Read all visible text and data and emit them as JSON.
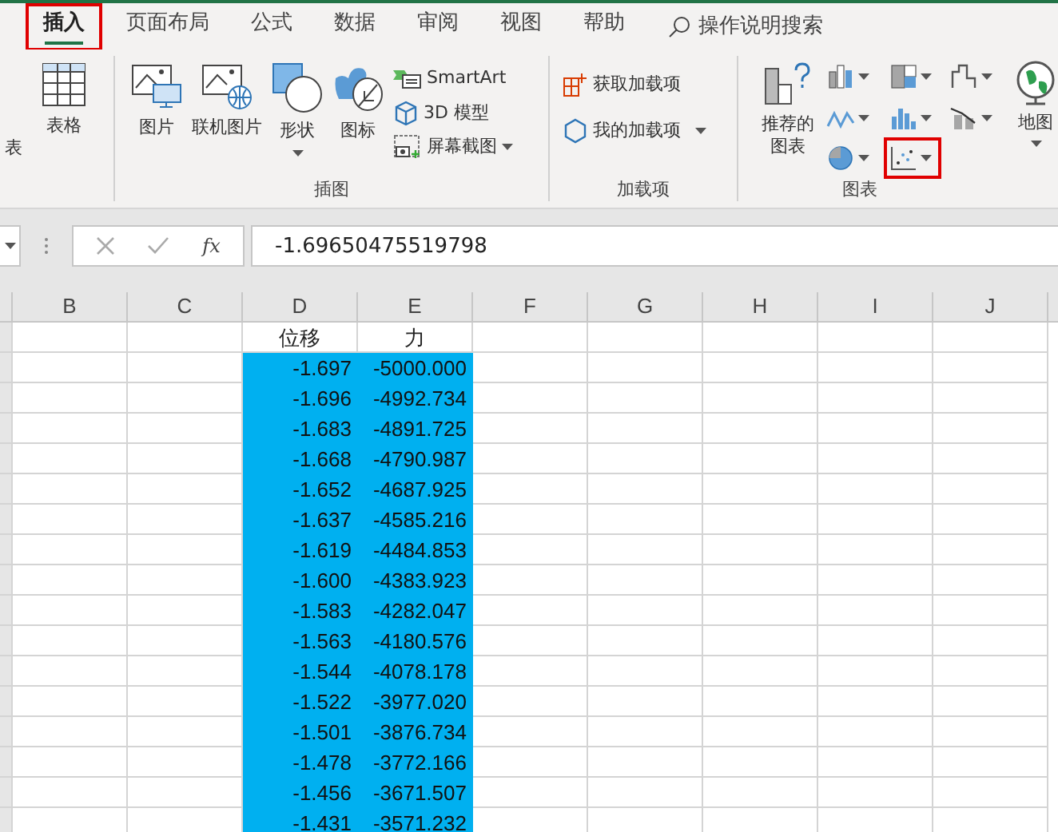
{
  "tabs": [
    {
      "label": "插入",
      "selected": true,
      "highlighted": true
    },
    {
      "label": "页面布局",
      "selected": false,
      "highlighted": false
    },
    {
      "label": "公式",
      "selected": false,
      "highlighted": false
    },
    {
      "label": "数据",
      "selected": false,
      "highlighted": false
    },
    {
      "label": "审阅",
      "selected": false,
      "highlighted": false
    },
    {
      "label": "视图",
      "selected": false,
      "highlighted": false
    },
    {
      "label": "帮助",
      "selected": false,
      "highlighted": false
    }
  ],
  "search": {
    "placeholder": "操作说明搜索"
  },
  "ribbon": {
    "tables_group": {
      "partial_label": "表",
      "items": [
        "表格"
      ]
    },
    "illustrations_group": {
      "label": "插图",
      "large": [
        {
          "label": "图片",
          "dropdown": false
        },
        {
          "label": "联机图片",
          "dropdown": false
        },
        {
          "label": "形状",
          "dropdown": true
        },
        {
          "label": "图标",
          "dropdown": false
        }
      ],
      "small": [
        {
          "label": "SmartArt",
          "dropdown": false
        },
        {
          "label": "3D 模型",
          "dropdown": false
        },
        {
          "label": "屏幕截图",
          "dropdown": true
        }
      ]
    },
    "addins_group": {
      "label": "加载项",
      "items": [
        {
          "label": "获取加载项",
          "dropdown": false
        },
        {
          "label": "我的加载项",
          "dropdown": true
        }
      ]
    },
    "charts_group": {
      "label": "图表",
      "recommended": "推荐的图表",
      "small_charts": [
        {
          "kind": "column",
          "highlighted": false
        },
        {
          "kind": "hierarchy",
          "highlighted": false
        },
        {
          "kind": "waterfall",
          "highlighted": false
        },
        {
          "kind": "line",
          "highlighted": false
        },
        {
          "kind": "statistic",
          "highlighted": false
        },
        {
          "kind": "combo",
          "highlighted": false
        },
        {
          "kind": "pie",
          "highlighted": false
        },
        {
          "kind": "scatter",
          "highlighted": true
        }
      ],
      "map": "地图"
    }
  },
  "formula_bar": {
    "fx": "fx",
    "value": "-1.69650475519798"
  },
  "sheet": {
    "columns": [
      "B",
      "C",
      "D",
      "E",
      "F",
      "G",
      "H",
      "I",
      "J"
    ],
    "headers": {
      "d": "位移",
      "e": "力"
    },
    "rows": [
      {
        "d": "-1.697",
        "e": "-5000.000"
      },
      {
        "d": "-1.696",
        "e": "-4992.734"
      },
      {
        "d": "-1.683",
        "e": "-4891.725"
      },
      {
        "d": "-1.668",
        "e": "-4790.987"
      },
      {
        "d": "-1.652",
        "e": "-4687.925"
      },
      {
        "d": "-1.637",
        "e": "-4585.216"
      },
      {
        "d": "-1.619",
        "e": "-4484.853"
      },
      {
        "d": "-1.600",
        "e": "-4383.923"
      },
      {
        "d": "-1.583",
        "e": "-4282.047"
      },
      {
        "d": "-1.563",
        "e": "-4180.576"
      },
      {
        "d": "-1.544",
        "e": "-4078.178"
      },
      {
        "d": "-1.522",
        "e": "-3977.020"
      },
      {
        "d": "-1.501",
        "e": "-3876.734"
      },
      {
        "d": "-1.478",
        "e": "-3772.166"
      },
      {
        "d": "-1.456",
        "e": "-3671.507"
      },
      {
        "d": "-1.431",
        "e": "-3571.232"
      }
    ],
    "selected": true
  }
}
